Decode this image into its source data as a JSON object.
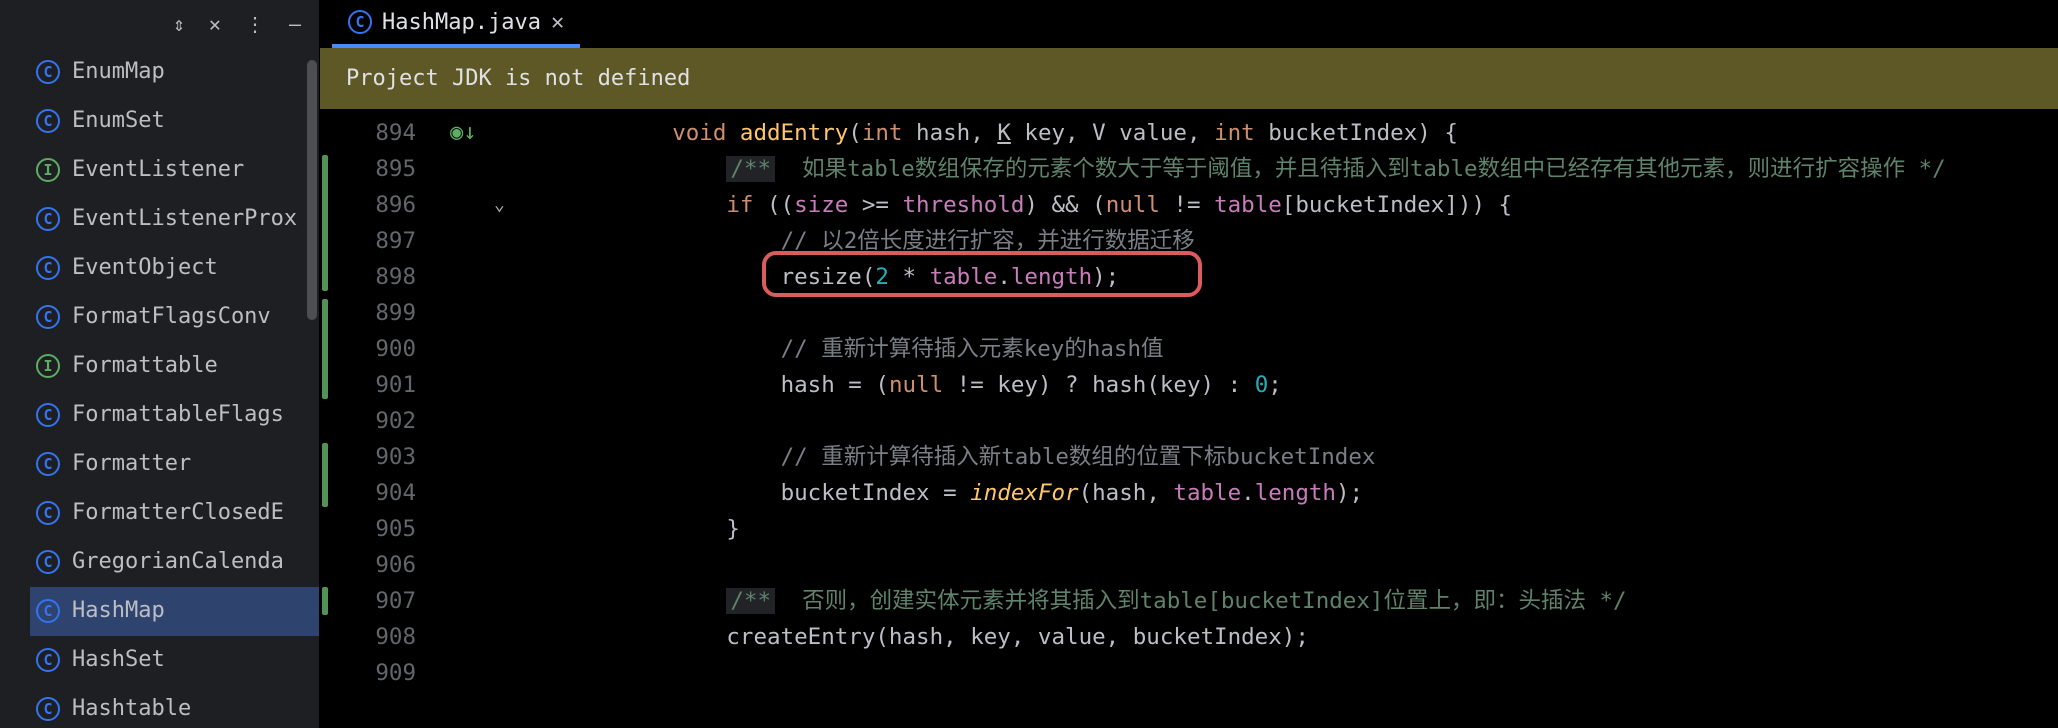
{
  "sidebar": {
    "toolstrip": {
      "collapse": "⇕",
      "close": "✕",
      "more": "⋮",
      "minimize": "—"
    },
    "items": [
      {
        "icon": "c",
        "label": "EnumMap"
      },
      {
        "icon": "c",
        "label": "EnumSet"
      },
      {
        "icon": "i",
        "label": "EventListener"
      },
      {
        "icon": "c",
        "label": "EventListenerProx"
      },
      {
        "icon": "c",
        "label": "EventObject"
      },
      {
        "icon": "c",
        "label": "FormatFlagsConv"
      },
      {
        "icon": "i",
        "label": "Formattable"
      },
      {
        "icon": "c",
        "label": "FormattableFlags"
      },
      {
        "icon": "c",
        "label": "Formatter"
      },
      {
        "icon": "c",
        "label": "FormatterClosedE"
      },
      {
        "icon": "c",
        "label": "GregorianCalenda"
      },
      {
        "icon": "c",
        "label": "HashMap",
        "selected": true
      },
      {
        "icon": "c",
        "label": "HashSet"
      },
      {
        "icon": "c",
        "label": "Hashtable"
      }
    ]
  },
  "tab": {
    "icon": "c",
    "title": "HashMap.java",
    "close": "✕"
  },
  "banner": {
    "text": "Project JDK is not defined"
  },
  "gutter": {
    "start": 894,
    "end": 909,
    "vcs_marks": [
      {
        "from": 895,
        "to": 898
      },
      {
        "from": 899,
        "to": 901
      },
      {
        "from": 903,
        "to": 904
      },
      {
        "from": 907,
        "to": 907
      }
    ],
    "run_line": 894,
    "fold_line": 896
  },
  "highlight": {
    "line": 898,
    "text": "resize(2 * table.length);"
  },
  "code": {
    "lines": {
      "894": [
        {
          "c": "kw",
          "t": "void "
        },
        {
          "c": "fn",
          "t": "addEntry"
        },
        {
          "c": "op",
          "t": "("
        },
        {
          "c": "kw",
          "t": "int "
        },
        {
          "c": "id",
          "t": "hash, "
        },
        {
          "c": "param",
          "t": "K"
        },
        {
          "c": "id",
          "t": " key, "
        },
        {
          "c": "id",
          "t": "V"
        },
        {
          "c": "id",
          "t": " value, "
        },
        {
          "c": "kw",
          "t": "int "
        },
        {
          "c": "id",
          "t": "bucketIndex"
        },
        {
          "c": "op",
          "t": ") {"
        }
      ],
      "895": [
        {
          "c": "doc-open",
          "t": "/**"
        },
        {
          "c": "doc-body",
          "t": "  如果table数组保存的元素个数大于等于阈值，并且待插入到table数组中已经存有其他元素，则进行扩容操作 */"
        }
      ],
      "896": [
        {
          "c": "kw",
          "t": "if "
        },
        {
          "c": "op",
          "t": "(("
        },
        {
          "c": "field",
          "t": "size"
        },
        {
          "c": "op",
          "t": " >= "
        },
        {
          "c": "field",
          "t": "threshold"
        },
        {
          "c": "op",
          "t": ") && ("
        },
        {
          "c": "kwnull",
          "t": "null"
        },
        {
          "c": "op",
          "t": " != "
        },
        {
          "c": "field",
          "t": "table"
        },
        {
          "c": "op",
          "t": "[bucketIndex])) {"
        }
      ],
      "897": [
        {
          "c": "cmt",
          "t": "// 以2倍长度进行扩容，并进行数据迁移"
        }
      ],
      "898": [
        {
          "c": "id",
          "t": "resize("
        },
        {
          "c": "num",
          "t": "2"
        },
        {
          "c": "op",
          "t": " * "
        },
        {
          "c": "field",
          "t": "table"
        },
        {
          "c": "op",
          "t": "."
        },
        {
          "c": "field",
          "t": "length"
        },
        {
          "c": "op",
          "t": ");"
        }
      ],
      "899": [],
      "900": [
        {
          "c": "cmt",
          "t": "// 重新计算待插入元素key的hash值"
        }
      ],
      "901": [
        {
          "c": "id",
          "t": "hash = ("
        },
        {
          "c": "kwnull",
          "t": "null"
        },
        {
          "c": "op",
          "t": " != key) ? "
        },
        {
          "c": "id",
          "t": "hash(key) : "
        },
        {
          "c": "num",
          "t": "0"
        },
        {
          "c": "op",
          "t": ";"
        }
      ],
      "902": [],
      "903": [
        {
          "c": "cmt",
          "t": "// 重新计算待插入新table数组的位置下标bucketIndex"
        }
      ],
      "904": [
        {
          "c": "id",
          "t": "bucketIndex = "
        },
        {
          "c": "fn-it",
          "t": "indexFor"
        },
        {
          "c": "op",
          "t": "(hash, "
        },
        {
          "c": "field",
          "t": "table"
        },
        {
          "c": "op",
          "t": "."
        },
        {
          "c": "field",
          "t": "length"
        },
        {
          "c": "op",
          "t": ");"
        }
      ],
      "905": [
        {
          "c": "op",
          "t": "}"
        }
      ],
      "906": [],
      "907": [
        {
          "c": "doc-open",
          "t": "/**"
        },
        {
          "c": "doc-body",
          "t": "  否则，创建实体元素并将其插入到table[bucketIndex]位置上，即：头插法 */"
        }
      ],
      "908": [
        {
          "c": "id",
          "t": "createEntry(hash, key, value, bucketIndex);"
        }
      ],
      "909": []
    },
    "indents": {
      "894": 4,
      "895": 8,
      "896": 8,
      "897": 12,
      "898": 12,
      "899": 12,
      "900": 12,
      "901": 12,
      "902": 12,
      "903": 12,
      "904": 12,
      "905": 8,
      "906": 8,
      "907": 8,
      "908": 8,
      "909": 4
    }
  }
}
